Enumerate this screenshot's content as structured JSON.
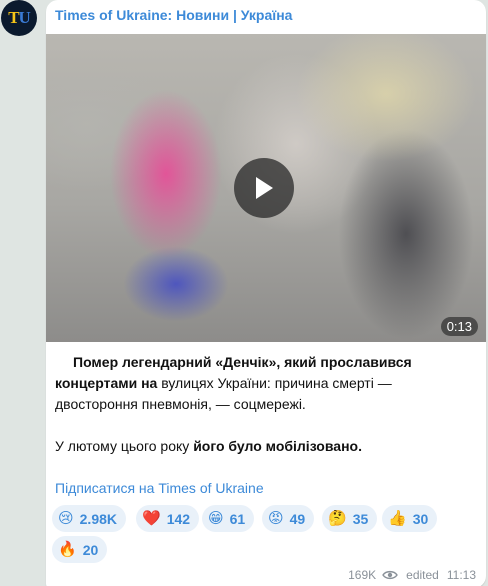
{
  "channel": {
    "avatar_t": "T",
    "avatar_u": "U",
    "name": "Times of Ukraine: Новини | Україна"
  },
  "video": {
    "duration": "0:13"
  },
  "post": {
    "p1_bold": "Помер легендарний «Денчік», який прославився концертами на",
    "p1_rest": " вулицях України: причина смерті — двостороння пневмонія, — соцмережі.",
    "p2_plain": "У лютому цього року ",
    "p2_bold": "його було мобілізовано."
  },
  "subscribe_link": "Підписатися на Times of Ukraine",
  "reactions": [
    {
      "emoji": "😢",
      "count": "2.98K"
    },
    {
      "emoji": "❤️",
      "count": "142"
    },
    {
      "emoji": "😁",
      "count": "61"
    },
    {
      "emoji": "😡",
      "count": "49"
    },
    {
      "emoji": "🤔",
      "count": "35"
    },
    {
      "emoji": "👍",
      "count": "30"
    },
    {
      "emoji": "🔥",
      "count": "20"
    }
  ],
  "meta": {
    "views": "169K",
    "edited": "edited",
    "time": "11:13"
  },
  "colors": {
    "accent": "#3d8ad8",
    "reaction_bg": "#e9f1f9",
    "chat_bg": "#dfe5e2"
  }
}
